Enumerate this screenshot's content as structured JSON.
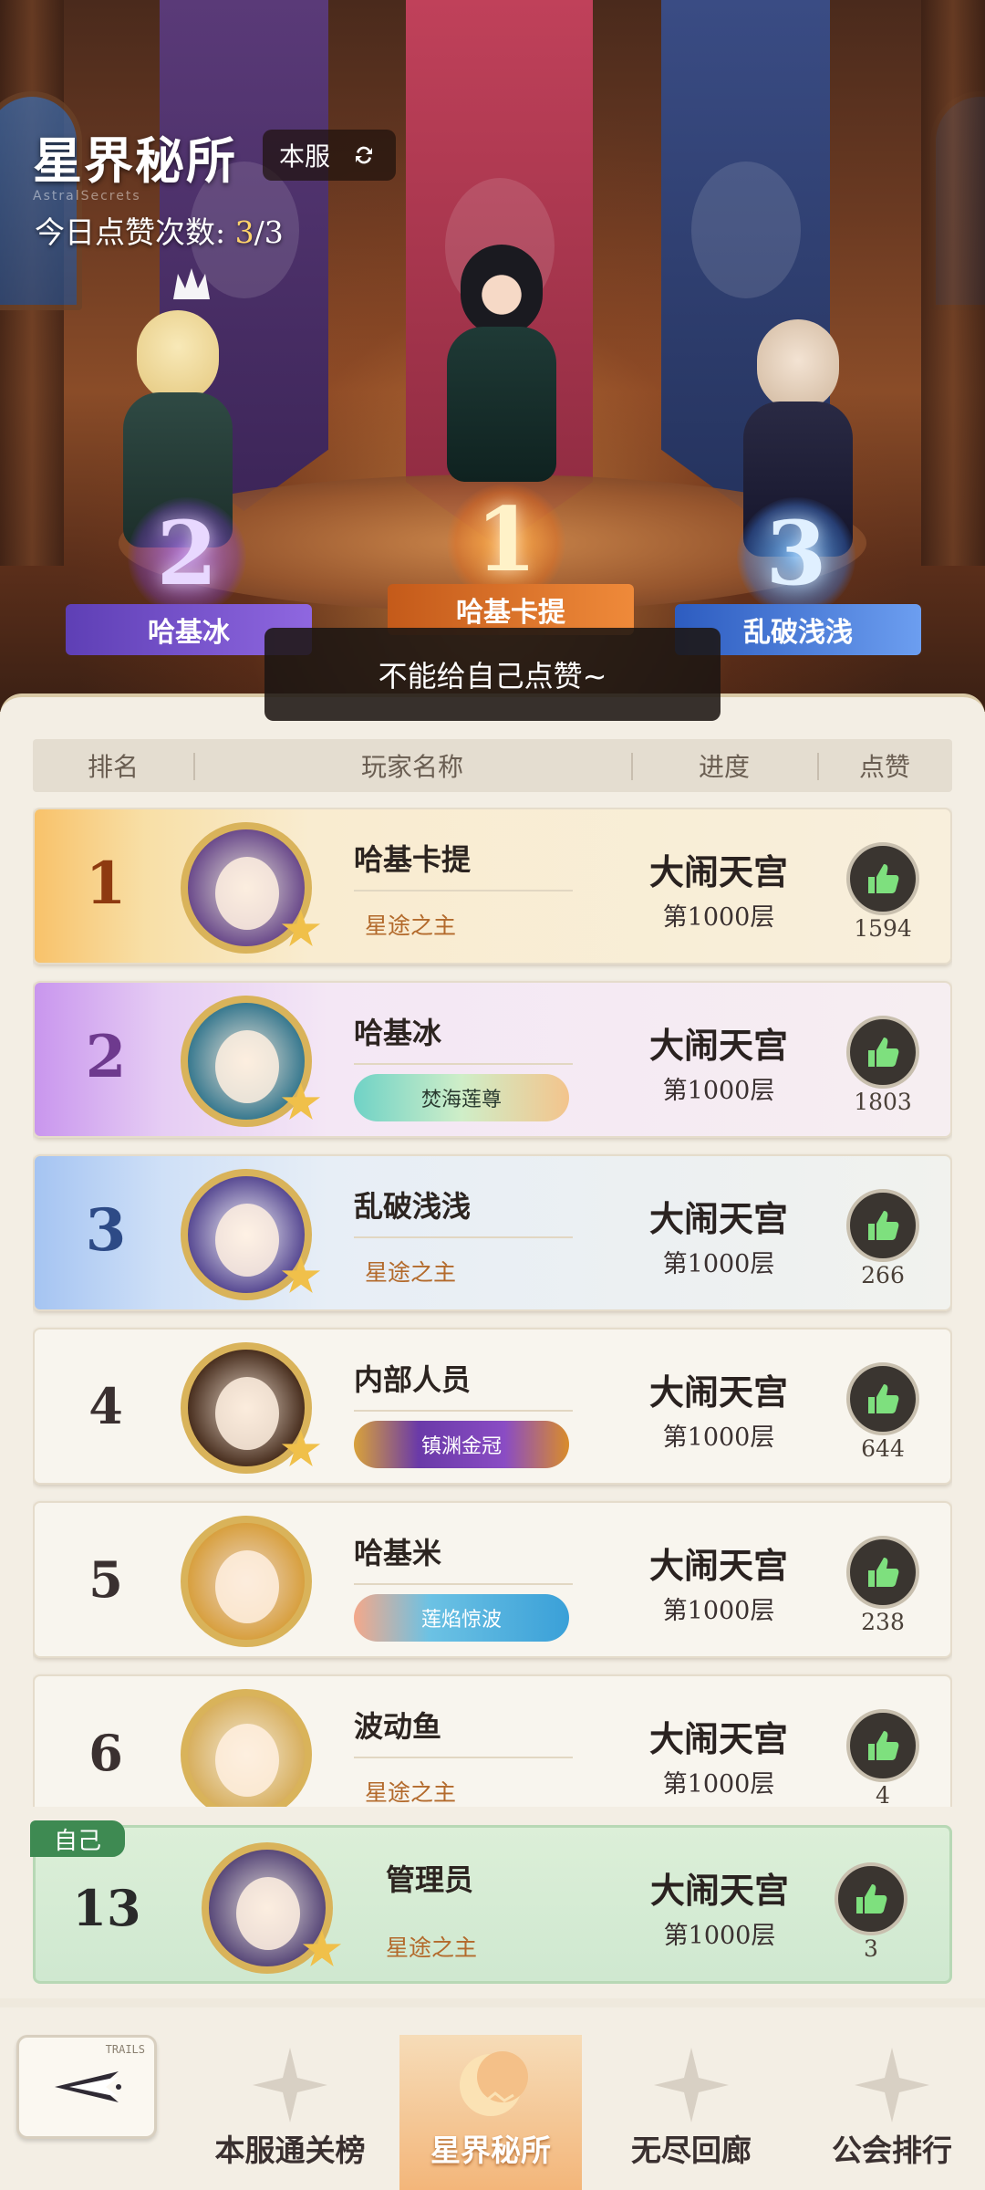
{
  "hero": {
    "title": "星界秘所",
    "subtitle_en": "AstralSecrets",
    "server_toggle": "本服",
    "likes_prefix": "今日点赞次数: ",
    "likes_used": "3",
    "likes_total": "/3",
    "podium": [
      {
        "rank": "2",
        "name": "哈基冰"
      },
      {
        "rank": "1",
        "name": "哈基卡提"
      },
      {
        "rank": "3",
        "name": "乱破浅浅"
      }
    ]
  },
  "toast": "不能给自己点赞~",
  "table": {
    "headers": {
      "rank": "排名",
      "name": "玩家名称",
      "progress": "进度",
      "likes": "点赞"
    },
    "rows": [
      {
        "rank": "1",
        "name": "哈基卡提",
        "title": "星途之主",
        "badge": "",
        "stage": "大闹天宫",
        "floor": "第1000层",
        "likes": "1594"
      },
      {
        "rank": "2",
        "name": "哈基冰",
        "title": "",
        "badge": "焚海莲尊",
        "stage": "大闹天宫",
        "floor": "第1000层",
        "likes": "1803"
      },
      {
        "rank": "3",
        "name": "乱破浅浅",
        "title": "星途之主",
        "badge": "",
        "stage": "大闹天宫",
        "floor": "第1000层",
        "likes": "266"
      },
      {
        "rank": "4",
        "name": "内部人员",
        "title": "",
        "badge": "镇渊金冠",
        "stage": "大闹天宫",
        "floor": "第1000层",
        "likes": "644"
      },
      {
        "rank": "5",
        "name": "哈基米",
        "title": "",
        "badge": "莲焰惊波",
        "stage": "大闹天宫",
        "floor": "第1000层",
        "likes": "238"
      },
      {
        "rank": "6",
        "name": "波动鱼",
        "title": "星途之主",
        "badge": "",
        "stage": "大闹天宫",
        "floor": "第1000层",
        "likes": "4"
      }
    ]
  },
  "self": {
    "tag": "自己",
    "rank": "13",
    "name": "管理员",
    "title": "星途之主",
    "stage": "大闹天宫",
    "floor": "第1000层",
    "likes": "3"
  },
  "nav": {
    "back_tag": "TRAILS",
    "tabs": [
      {
        "label": "本服通关榜"
      },
      {
        "label": "星界秘所",
        "active": true
      },
      {
        "label": "无尽回廊"
      },
      {
        "label": "公会排行"
      }
    ]
  },
  "colors": {
    "like_green": "#7ee07e",
    "accent_gold": "#d9b35a",
    "self_green": "#3e8a52"
  }
}
